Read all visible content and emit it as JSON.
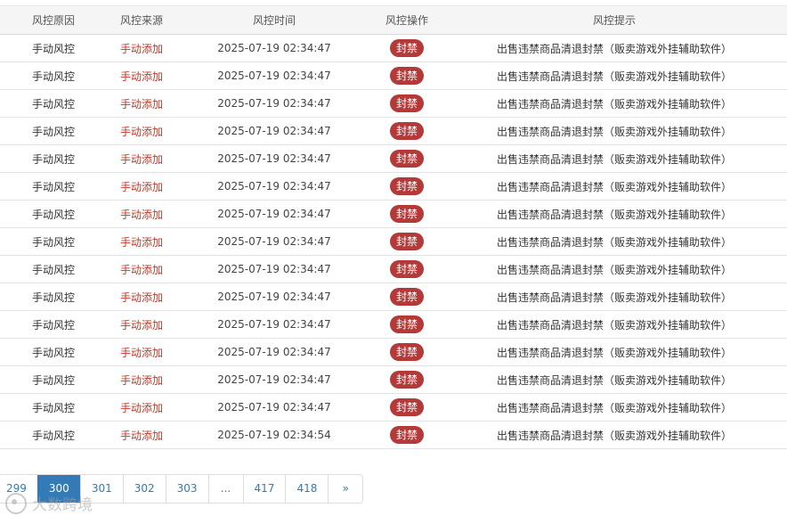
{
  "table": {
    "headers": [
      "风控原因",
      "风控来源",
      "风控时间",
      "风控操作",
      "风控提示"
    ],
    "rows": [
      {
        "reason": "手动风控",
        "source": "手动添加",
        "time": "2025-07-19 02:34:47",
        "action": "封禁",
        "tip": "出售违禁商品清退封禁（贩卖游戏外挂辅助软件）"
      },
      {
        "reason": "手动风控",
        "source": "手动添加",
        "time": "2025-07-19 02:34:47",
        "action": "封禁",
        "tip": "出售违禁商品清退封禁（贩卖游戏外挂辅助软件）"
      },
      {
        "reason": "手动风控",
        "source": "手动添加",
        "time": "2025-07-19 02:34:47",
        "action": "封禁",
        "tip": "出售违禁商品清退封禁（贩卖游戏外挂辅助软件）"
      },
      {
        "reason": "手动风控",
        "source": "手动添加",
        "time": "2025-07-19 02:34:47",
        "action": "封禁",
        "tip": "出售违禁商品清退封禁（贩卖游戏外挂辅助软件）"
      },
      {
        "reason": "手动风控",
        "source": "手动添加",
        "time": "2025-07-19 02:34:47",
        "action": "封禁",
        "tip": "出售违禁商品清退封禁（贩卖游戏外挂辅助软件）"
      },
      {
        "reason": "手动风控",
        "source": "手动添加",
        "time": "2025-07-19 02:34:47",
        "action": "封禁",
        "tip": "出售违禁商品清退封禁（贩卖游戏外挂辅助软件）"
      },
      {
        "reason": "手动风控",
        "source": "手动添加",
        "time": "2025-07-19 02:34:47",
        "action": "封禁",
        "tip": "出售违禁商品清退封禁（贩卖游戏外挂辅助软件）"
      },
      {
        "reason": "手动风控",
        "source": "手动添加",
        "time": "2025-07-19 02:34:47",
        "action": "封禁",
        "tip": "出售违禁商品清退封禁（贩卖游戏外挂辅助软件）"
      },
      {
        "reason": "手动风控",
        "source": "手动添加",
        "time": "2025-07-19 02:34:47",
        "action": "封禁",
        "tip": "出售违禁商品清退封禁（贩卖游戏外挂辅助软件）"
      },
      {
        "reason": "手动风控",
        "source": "手动添加",
        "time": "2025-07-19 02:34:47",
        "action": "封禁",
        "tip": "出售违禁商品清退封禁（贩卖游戏外挂辅助软件）"
      },
      {
        "reason": "手动风控",
        "source": "手动添加",
        "time": "2025-07-19 02:34:47",
        "action": "封禁",
        "tip": "出售违禁商品清退封禁（贩卖游戏外挂辅助软件）"
      },
      {
        "reason": "手动风控",
        "source": "手动添加",
        "time": "2025-07-19 02:34:47",
        "action": "封禁",
        "tip": "出售违禁商品清退封禁（贩卖游戏外挂辅助软件）"
      },
      {
        "reason": "手动风控",
        "source": "手动添加",
        "time": "2025-07-19 02:34:47",
        "action": "封禁",
        "tip": "出售违禁商品清退封禁（贩卖游戏外挂辅助软件）"
      },
      {
        "reason": "手动风控",
        "source": "手动添加",
        "time": "2025-07-19 02:34:47",
        "action": "封禁",
        "tip": "出售违禁商品清退封禁（贩卖游戏外挂辅助软件）"
      },
      {
        "reason": "手动风控",
        "source": "手动添加",
        "time": "2025-07-19 02:34:54",
        "action": "封禁",
        "tip": "出售违禁商品清退封禁（贩卖游戏外挂辅助软件）"
      }
    ]
  },
  "pagination": {
    "pages": [
      "299",
      "300",
      "301",
      "302",
      "303",
      "...",
      "417",
      "418",
      "»"
    ],
    "current": "300"
  },
  "watermark": {
    "text": "大数跨境",
    "logo_icon": "brand-logo-icon"
  },
  "colors": {
    "source_text": "#c0392b",
    "ban_badge": "#b33a38",
    "active_page": "#337ab7"
  }
}
